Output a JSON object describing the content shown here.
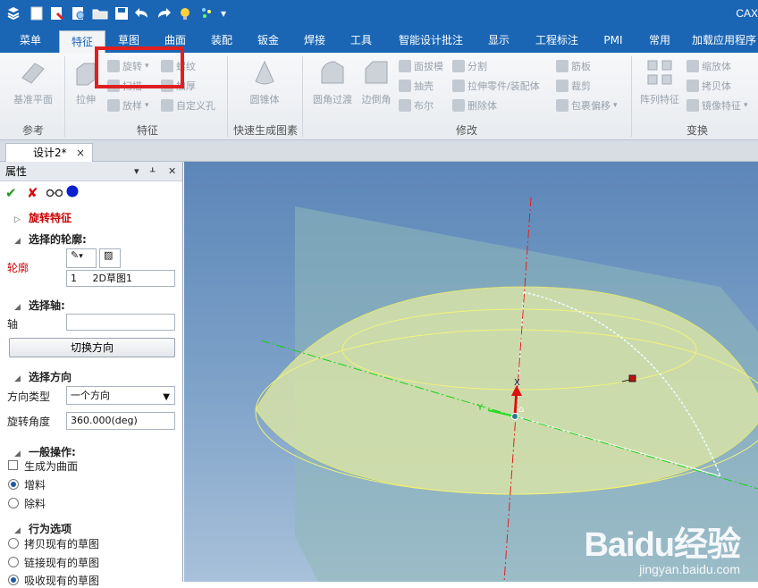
{
  "app": {
    "title": "CAX"
  },
  "quick_access": [
    "app-logo-icon",
    "new-file-icon",
    "save-as-icon",
    "print-icon",
    "open-folder-icon",
    "save-icon",
    "undo-icon",
    "redo-icon",
    "light-bulb-icon",
    "effects-icon",
    "dropdown-icon"
  ],
  "menu_tabs": [
    {
      "label": "菜单"
    },
    {
      "label": "特征"
    },
    {
      "label": "草图"
    },
    {
      "label": "曲面"
    },
    {
      "label": "装配"
    },
    {
      "label": "钣金"
    },
    {
      "label": "焊接"
    },
    {
      "label": "工具"
    },
    {
      "label": "智能设计批注"
    },
    {
      "label": "显示"
    },
    {
      "label": "工程标注"
    },
    {
      "label": "PMI"
    },
    {
      "label": "常用"
    },
    {
      "label": "加载应用程序"
    }
  ],
  "active_tab": "特征",
  "ribbon": {
    "ref_group": {
      "label": "参考",
      "plane_btn": "基准平面"
    },
    "feature_group": {
      "label": "特征",
      "extrude": "拉伸",
      "revolve": "旋转",
      "thread": "螺纹",
      "sweep": "扫描",
      "thicken": "加厚",
      "loft": "放样",
      "custom_hole": "自定义孔"
    },
    "quick_group": {
      "label": "快速生成图素",
      "cone": "圆锥体"
    },
    "modify_group": {
      "label": "修改",
      "fillet": "圆角过渡",
      "chamfer": "边倒角",
      "draft": "面拔模",
      "split": "分割",
      "shell": "抽壳",
      "extrude_part": "拉伸零件/装配体",
      "boolean": "布尔",
      "delete_body": "删除体",
      "rib": "筋板",
      "trim": "裁剪",
      "wrap_offset": "包裹偏移"
    },
    "transform_group": {
      "label": "变换",
      "pattern": "阵列特征",
      "scale": "缩放体",
      "copy": "拷贝体",
      "mirror": "镜像特征"
    }
  },
  "doc_tab": {
    "label": "设计2*",
    "close": "×"
  },
  "panel": {
    "title": "属性",
    "feature_name": "旋转特征",
    "sec_profile": "选择的轮廓:",
    "profile_label": "轮廓",
    "profile_item_index": "1",
    "profile_item_name": "2D草图1",
    "sec_axis": "选择轴:",
    "axis_label": "轴",
    "axis_value": "",
    "switch_dir": "切换方向",
    "sec_direction": "选择方向",
    "dir_type_label": "方向类型",
    "dir_type_value": "一个方向",
    "angle_label": "旋转角度",
    "angle_value": "360.000(deg)",
    "sec_general": "一般操作:",
    "make_surface": "生成为曲面",
    "add_material": "增料",
    "remove_material": "除料",
    "sec_behavior": "行为选项",
    "copy_sketch": "拷贝现有的草图",
    "link_sketch": "链接现有的草图",
    "absorb_sketch": "吸收现有的草图"
  },
  "viewport": {
    "axis_x_label": "X",
    "axis_y_label": "Y"
  },
  "watermark": {
    "brand": "Baidu经验",
    "url": "jingyan.baidu.com"
  },
  "colors": {
    "brand_blue": "#1a66b5",
    "feature_red": "#cc0000",
    "highlight_red": "#e02020"
  }
}
